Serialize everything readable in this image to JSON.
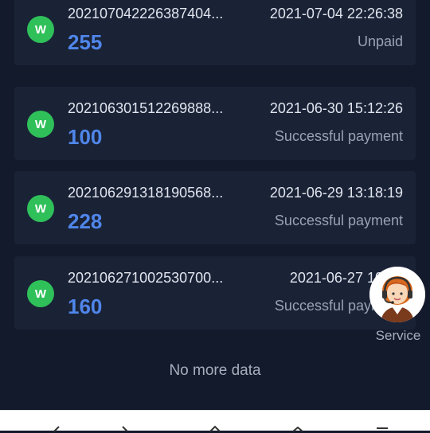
{
  "orders": [
    {
      "badge": "W",
      "id": "202107042226387404...",
      "amount": "255",
      "date": "2021-07-04 22:26:38",
      "status": "Unpaid"
    },
    {
      "badge": "W",
      "id": "202106301512269888...",
      "amount": "100",
      "date": "2021-06-30 15:12:26",
      "status": "Successful payment"
    },
    {
      "badge": "W",
      "id": "202106291318190568...",
      "amount": "228",
      "date": "2021-06-29 13:18:19",
      "status": "Successful payment"
    },
    {
      "badge": "W",
      "id": "202106271002530700...",
      "amount": "160",
      "date": "2021-06-27 10:02",
      "status": "Successful payment"
    }
  ],
  "footer": {
    "no_more": "No more data"
  },
  "service": {
    "label": "Service",
    "icon": "customer-service-agent-icon"
  },
  "navbar": {
    "icons": [
      "back-icon",
      "forward-icon",
      "home-icon",
      "share-icon",
      "menu-icon"
    ]
  },
  "colors": {
    "background": "#131a2b",
    "card": "#1a2236",
    "badge": "#2fc05a",
    "amount": "#4f86ea"
  }
}
